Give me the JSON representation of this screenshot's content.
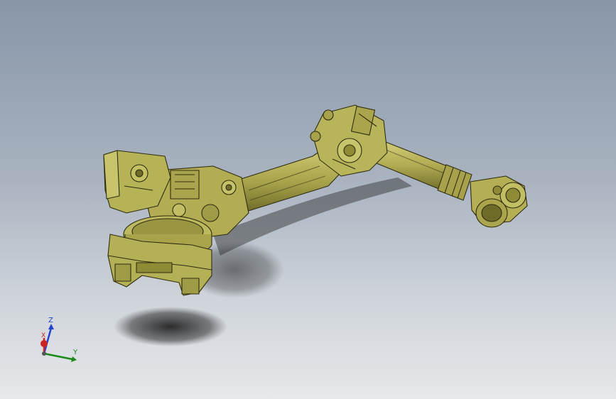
{
  "viewport": {
    "background_top": "#8896a8",
    "background_bottom": "#e6e8ea"
  },
  "model": {
    "part_color": "#b8b45a",
    "edge_color": "#2f2c10"
  },
  "triad": {
    "x_label": "X",
    "y_label": "Y",
    "z_label": "Z",
    "x_color": "#cc2222",
    "y_color": "#1a8a1a",
    "z_color": "#2244cc"
  }
}
